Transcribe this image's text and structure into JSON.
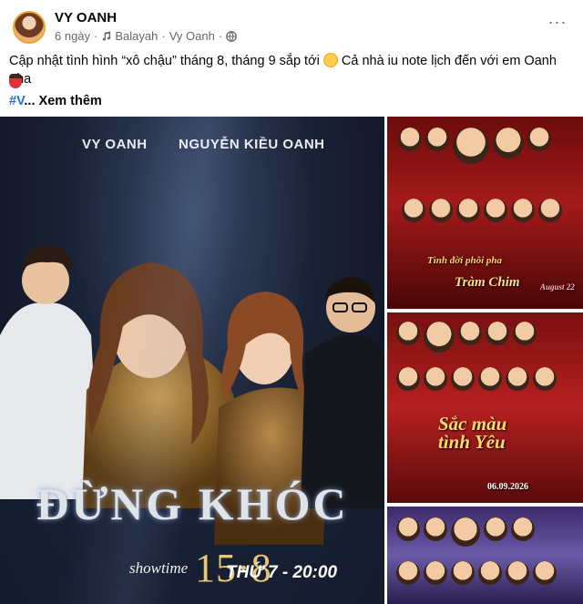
{
  "post": {
    "author": "VY OANH",
    "time": "6 ngày",
    "location": "Balayah",
    "tag": "Vy Oanh",
    "more": "···"
  },
  "caption": {
    "line1": "Cập nhật tình hình “xô chậu” tháng 8, tháng 9 sắp tới",
    "line1_tail": "Cả nhà iu note lịch đến với em Oanh nha",
    "hashtag": "#V",
    "see_more": "... Xem thêm"
  },
  "main_poster": {
    "name1": "VY OANH",
    "name2": "NGUYỄN KIỀU OANH",
    "title": "ĐỪNG KHÓC",
    "showtime": "showtime",
    "date": "15·8",
    "day": "THỨ 7 - 20:00"
  },
  "side1": {
    "title_small": "Tình đời phôi pha",
    "title_main": "Tràm Chim",
    "date": "August 22"
  },
  "side2": {
    "title": "Sắc màu tình Yêu",
    "date": "06.09.2026"
  },
  "colors": {
    "accent": "#216fdb",
    "meta_gray": "#65676b",
    "gold": "#e8c774"
  },
  "icons": [
    "globe-icon",
    "music-icon",
    "more-icon"
  ]
}
